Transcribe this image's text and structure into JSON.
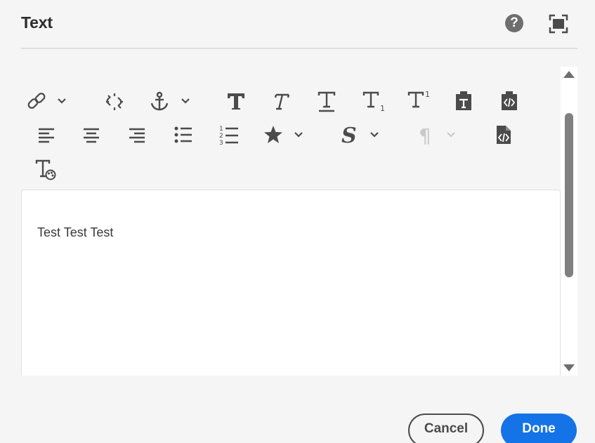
{
  "dialog": {
    "title": "Text",
    "help_glyph": "?",
    "help_icon": "help-circle-icon",
    "fullscreen_icon": "fullscreen-icon"
  },
  "toolbar": {
    "row1": [
      {
        "icon": "link-icon",
        "dropdown": true
      },
      {
        "icon": "unlink-icon"
      },
      {
        "icon": "anchor-icon",
        "dropdown": true
      },
      {
        "icon": "bold-icon"
      },
      {
        "icon": "italic-icon"
      },
      {
        "icon": "underline-icon"
      },
      {
        "icon": "subscript-icon"
      },
      {
        "icon": "superscript-icon"
      },
      {
        "icon": "paste-as-text-icon"
      },
      {
        "icon": "paste-wordfile-icon"
      }
    ],
    "row2": [
      {
        "icon": "align-left-icon"
      },
      {
        "icon": "align-center-icon"
      },
      {
        "icon": "align-right-icon"
      },
      {
        "icon": "bullet-list-icon"
      },
      {
        "icon": "numbered-list-icon"
      },
      {
        "icon": "star-icon",
        "dropdown": true
      },
      {
        "icon": "style-s-icon",
        "dropdown": true
      },
      {
        "icon": "paragraph-icon",
        "dropdown": true,
        "disabled": true
      },
      {
        "icon": "source-edit-icon"
      }
    ],
    "row3": [
      {
        "icon": "text-color-icon"
      }
    ],
    "subscript_index": "1",
    "superscript_index": "1",
    "style_letter": "S",
    "paragraph_glyph": "¶"
  },
  "editor": {
    "content": "Test Test Test"
  },
  "footer": {
    "cancel_label": "Cancel",
    "done_label": "Done"
  },
  "colors": {
    "primary": "#1473e6",
    "icon": "#4b4b4b",
    "disabled_icon": "#c9c9c9",
    "scroll_thumb": "#808080"
  }
}
